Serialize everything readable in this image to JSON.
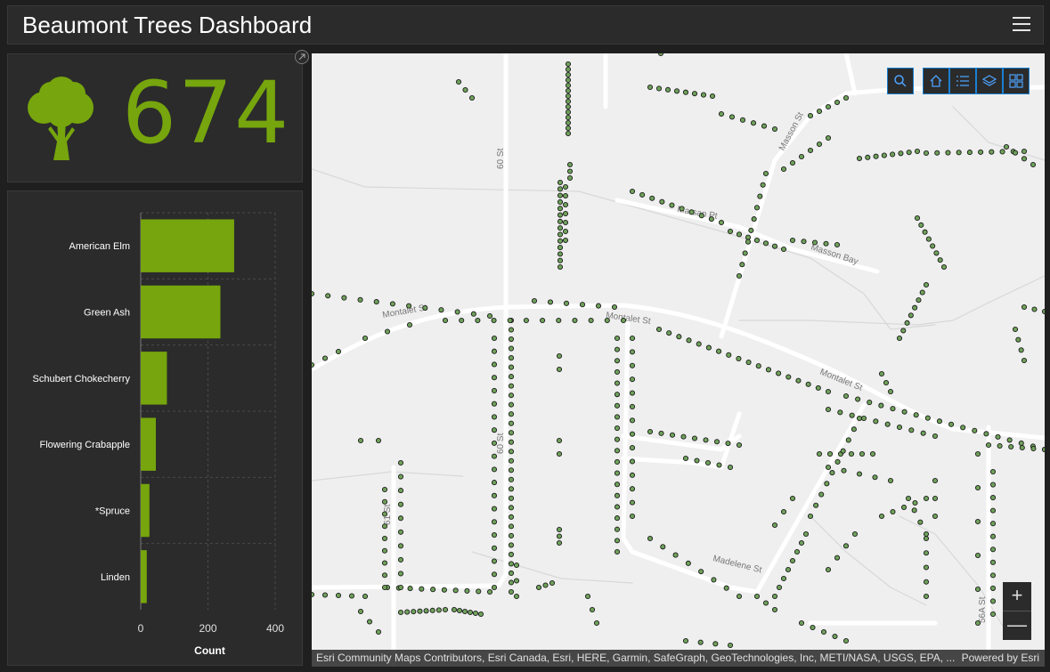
{
  "header": {
    "title": "Beaumont Trees Dashboard",
    "menu_icon": "hamburger-menu-icon"
  },
  "indicator": {
    "value": "674",
    "icon": "tree-icon",
    "color": "#76a50d"
  },
  "chart_data": {
    "type": "bar",
    "orientation": "horizontal",
    "categories": [
      "American Elm",
      "Green Ash",
      "Schubert Chokecherry",
      "Flowering Crabapple",
      "*Spruce",
      "Linden"
    ],
    "values": [
      278,
      237,
      78,
      45,
      26,
      18
    ],
    "xlabel": "Count",
    "xlim": [
      0,
      400
    ],
    "xticks": [
      0,
      200,
      400
    ],
    "color": "#76a50d",
    "grid": true
  },
  "map": {
    "streets": [
      "Montalet St",
      "Montalet St",
      "Montalet St",
      "Masson St",
      "Marsan Pt",
      "Masson Bay",
      "60 St",
      "60 St",
      "61 St",
      "Madelene St",
      "56A St"
    ],
    "toolbar": [
      "search-icon",
      "home-icon",
      "legend-icon",
      "layers-icon",
      "basemap-gallery-icon"
    ],
    "zoom_in_label": "+",
    "zoom_out_label": "—",
    "attribution": "Esri Community Maps Contributors, Esri Canada, Esri, HERE, Garmin, SafeGraph, GeoTechnologies, Inc, METI/NASA, USGS, EPA, ...",
    "powered_by": "Powered by Esri",
    "tree_color": "#6fa25a"
  }
}
